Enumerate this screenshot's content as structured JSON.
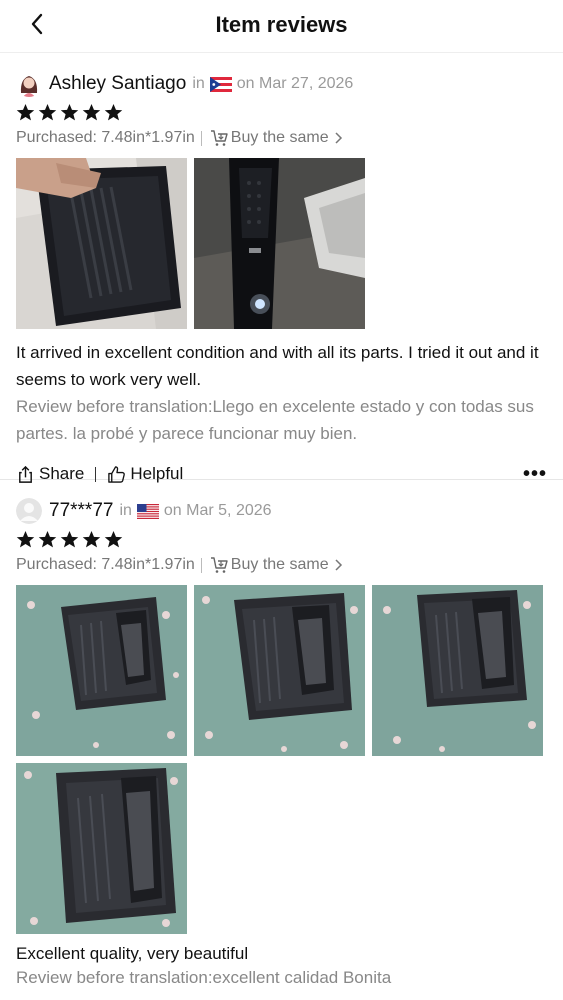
{
  "header": {
    "title": "Item reviews"
  },
  "reviews": [
    {
      "username": "Ashley Santiago",
      "in_label": "in",
      "country_icon": "puerto-rico-flag-icon",
      "date": "on Mar 27, 2026",
      "rating": 5,
      "purchased": "Purchased: 7.48in*1.97in",
      "buy_same": "Buy the same",
      "text": "It arrived in excellent condition and with all its parts. I tried it out and it seems to work very well.",
      "original": "Review before translation:Llego en excelente estado y con todas sus partes. la probé y parece funcionar muy bien.",
      "share_label": "Share",
      "helpful_label": "Helpful",
      "more_label": "•••"
    },
    {
      "username": "77***77",
      "in_label": "in",
      "country_icon": "usa-flag-icon",
      "date": "on Mar 5, 2026",
      "rating": 5,
      "purchased": "Purchased: 7.48in*1.97in",
      "buy_same": "Buy the same",
      "text": "Excellent quality, very beautiful",
      "original": "Review before translation:excellent calidad Bonita"
    }
  ]
}
